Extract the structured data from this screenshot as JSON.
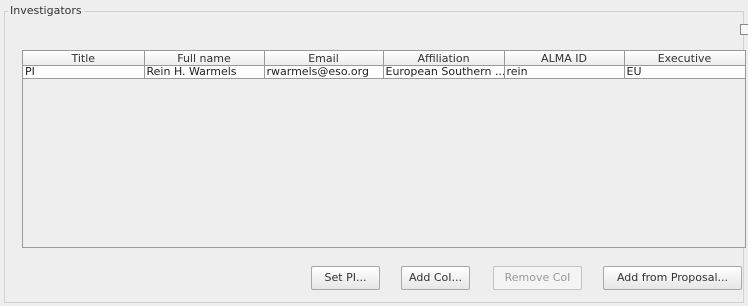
{
  "panel": {
    "title": "Investigators"
  },
  "table": {
    "columns": [
      "Title",
      "Full name",
      "Email",
      "Affiliation",
      "ALMA ID",
      "Executive"
    ],
    "rows": [
      {
        "title": "PI",
        "full_name": "Rein H. Warmels",
        "email": "rwarmels@eso.org",
        "affiliation": "European Southern ...",
        "alma_id": "rein",
        "executive": "EU"
      }
    ]
  },
  "buttons": {
    "set_pi": "Set PI...",
    "add_coi": "Add CoI...",
    "remove_coi": "Remove CoI",
    "add_from_proposal": "Add from Proposal..."
  }
}
